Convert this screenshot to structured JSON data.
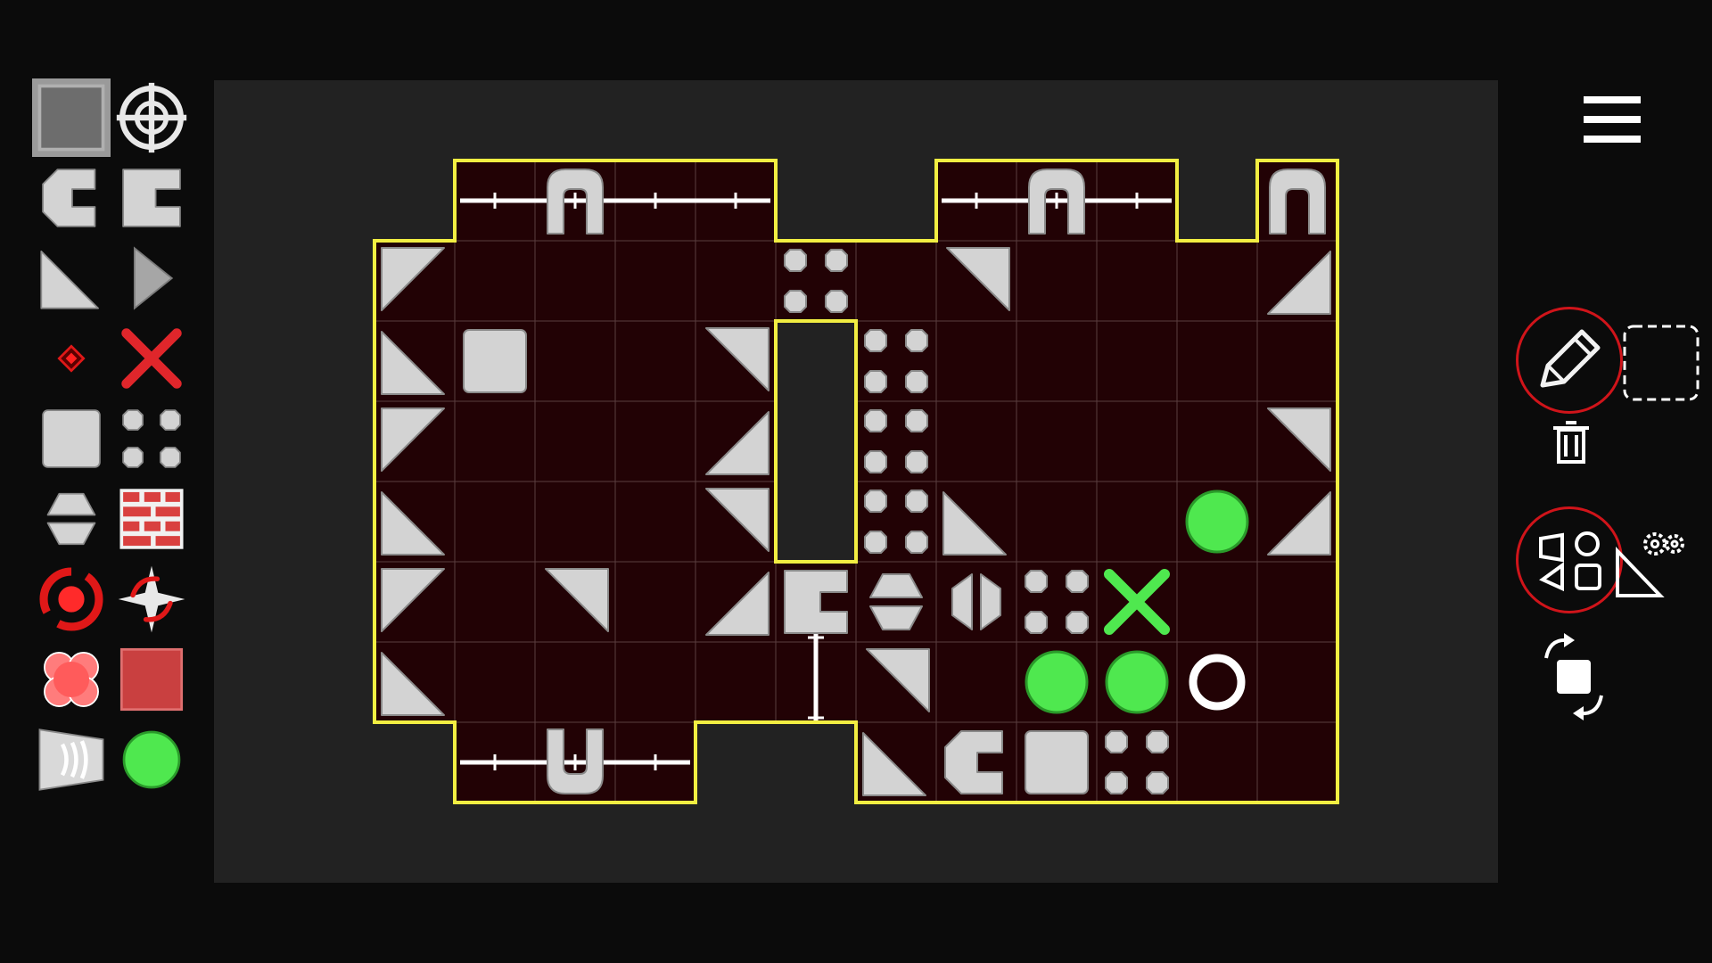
{
  "theme": {
    "page_bg": "#0b0b0b",
    "board_area_bg": "#222222",
    "cell_bg": "#220205",
    "grid_line": "#5a3e40",
    "outline": "#f2ee42",
    "block": "#d3d3d3",
    "accent_red": "#e0262b",
    "accent_green": "#4fe84f",
    "tool_ring": "#d0141a"
  },
  "palette": {
    "selected_index": 0,
    "items": [
      {
        "icon": "floor-tile-icon"
      },
      {
        "icon": "crosshair-target-icon"
      },
      {
        "icon": "c-block-icon"
      },
      {
        "icon": "bracket-block-icon"
      },
      {
        "icon": "triangle-block-icon"
      },
      {
        "icon": "arrow-tip-block-icon"
      },
      {
        "icon": "red-diamond-icon"
      },
      {
        "icon": "red-x-icon"
      },
      {
        "icon": "square-block-icon"
      },
      {
        "icon": "split-block-icon"
      },
      {
        "icon": "hourglass-block-icon"
      },
      {
        "icon": "brick-wall-icon"
      },
      {
        "icon": "red-rotator-icon"
      },
      {
        "icon": "spinner-star-icon"
      },
      {
        "icon": "red-cluster-icon"
      },
      {
        "icon": "red-square-icon"
      },
      {
        "icon": "speaker-block-icon"
      },
      {
        "icon": "green-ball-icon"
      }
    ]
  },
  "board": {
    "cells": [
      [
        1,
        0
      ],
      [
        2,
        0
      ],
      [
        3,
        0
      ],
      [
        4,
        0
      ],
      [
        7,
        0
      ],
      [
        8,
        0
      ],
      [
        9,
        0
      ],
      [
        11,
        0
      ],
      [
        0,
        1
      ],
      [
        1,
        1
      ],
      [
        2,
        1
      ],
      [
        3,
        1
      ],
      [
        4,
        1
      ],
      [
        5,
        1
      ],
      [
        6,
        1
      ],
      [
        7,
        1
      ],
      [
        8,
        1
      ],
      [
        9,
        1
      ],
      [
        10,
        1
      ],
      [
        11,
        1
      ],
      [
        0,
        2
      ],
      [
        1,
        2
      ],
      [
        2,
        2
      ],
      [
        3,
        2
      ],
      [
        4,
        2
      ],
      [
        6,
        2
      ],
      [
        7,
        2
      ],
      [
        8,
        2
      ],
      [
        9,
        2
      ],
      [
        10,
        2
      ],
      [
        11,
        2
      ],
      [
        0,
        3
      ],
      [
        1,
        3
      ],
      [
        2,
        3
      ],
      [
        3,
        3
      ],
      [
        4,
        3
      ],
      [
        6,
        3
      ],
      [
        7,
        3
      ],
      [
        8,
        3
      ],
      [
        9,
        3
      ],
      [
        10,
        3
      ],
      [
        11,
        3
      ],
      [
        0,
        4
      ],
      [
        1,
        4
      ],
      [
        2,
        4
      ],
      [
        3,
        4
      ],
      [
        4,
        4
      ],
      [
        6,
        4
      ],
      [
        7,
        4
      ],
      [
        8,
        4
      ],
      [
        9,
        4
      ],
      [
        10,
        4
      ],
      [
        11,
        4
      ],
      [
        0,
        5
      ],
      [
        1,
        5
      ],
      [
        2,
        5
      ],
      [
        3,
        5
      ],
      [
        4,
        5
      ],
      [
        5,
        5
      ],
      [
        6,
        5
      ],
      [
        7,
        5
      ],
      [
        8,
        5
      ],
      [
        9,
        5
      ],
      [
        10,
        5
      ],
      [
        11,
        5
      ],
      [
        0,
        6
      ],
      [
        1,
        6
      ],
      [
        2,
        6
      ],
      [
        3,
        6
      ],
      [
        4,
        6
      ],
      [
        5,
        6
      ],
      [
        6,
        6
      ],
      [
        7,
        6
      ],
      [
        8,
        6
      ],
      [
        9,
        6
      ],
      [
        10,
        6
      ],
      [
        11,
        6
      ],
      [
        1,
        7
      ],
      [
        2,
        7
      ],
      [
        3,
        7
      ],
      [
        6,
        7
      ],
      [
        7,
        7
      ],
      [
        8,
        7
      ],
      [
        9,
        7
      ],
      [
        10,
        7
      ],
      [
        11,
        7
      ]
    ],
    "rails": [
      {
        "dir": "h",
        "row": 0,
        "from": 1,
        "to": 4
      },
      {
        "dir": "h",
        "row": 0,
        "from": 7,
        "to": 9
      },
      {
        "dir": "h",
        "row": 7,
        "from": 1,
        "to": 3
      },
      {
        "dir": "v",
        "col": 5,
        "from": 5,
        "to": 6
      }
    ],
    "pieces": [
      {
        "c": 2,
        "r": 0,
        "t": "arch",
        "o": "down"
      },
      {
        "c": 8,
        "r": 0,
        "t": "arch",
        "o": "down"
      },
      {
        "c": 11,
        "r": 0,
        "t": "arch",
        "o": "down"
      },
      {
        "c": 0,
        "r": 1,
        "t": "tri",
        "o": "tl"
      },
      {
        "c": 5,
        "r": 1,
        "t": "quad"
      },
      {
        "c": 7,
        "r": 1,
        "t": "tri",
        "o": "tr"
      },
      {
        "c": 11,
        "r": 1,
        "t": "tri",
        "o": "br"
      },
      {
        "c": 0,
        "r": 2,
        "t": "tri",
        "o": "bl"
      },
      {
        "c": 1,
        "r": 2,
        "t": "square"
      },
      {
        "c": 4,
        "r": 2,
        "t": "tri",
        "o": "tr"
      },
      {
        "c": 6,
        "r": 2,
        "t": "quad"
      },
      {
        "c": 0,
        "r": 3,
        "t": "tri",
        "o": "tl"
      },
      {
        "c": 4,
        "r": 3,
        "t": "tri",
        "o": "br"
      },
      {
        "c": 6,
        "r": 3,
        "t": "quad"
      },
      {
        "c": 11,
        "r": 3,
        "t": "tri",
        "o": "tr"
      },
      {
        "c": 0,
        "r": 4,
        "t": "tri",
        "o": "bl"
      },
      {
        "c": 4,
        "r": 4,
        "t": "tri",
        "o": "tr"
      },
      {
        "c": 6,
        "r": 4,
        "t": "quad"
      },
      {
        "c": 7,
        "r": 4,
        "t": "tri",
        "o": "bl"
      },
      {
        "c": 10,
        "r": 4,
        "t": "ball"
      },
      {
        "c": 11,
        "r": 4,
        "t": "tri",
        "o": "br"
      },
      {
        "c": 0,
        "r": 5,
        "t": "tri",
        "o": "tl"
      },
      {
        "c": 2,
        "r": 5,
        "t": "tri",
        "o": "tr"
      },
      {
        "c": 4,
        "r": 5,
        "t": "tri",
        "o": "br"
      },
      {
        "c": 5,
        "r": 5,
        "t": "bracket"
      },
      {
        "c": 6,
        "r": 5,
        "t": "hourglass"
      },
      {
        "c": 7,
        "r": 5,
        "t": "split"
      },
      {
        "c": 8,
        "r": 5,
        "t": "quad"
      },
      {
        "c": 9,
        "r": 5,
        "t": "x"
      },
      {
        "c": 0,
        "r": 6,
        "t": "tri",
        "o": "bl"
      },
      {
        "c": 6,
        "r": 6,
        "t": "tri",
        "o": "tr"
      },
      {
        "c": 8,
        "r": 6,
        "t": "ball"
      },
      {
        "c": 9,
        "r": 6,
        "t": "ball"
      },
      {
        "c": 10,
        "r": 6,
        "t": "ring"
      },
      {
        "c": 2,
        "r": 7,
        "t": "arch",
        "o": "up"
      },
      {
        "c": 6,
        "r": 7,
        "t": "tri",
        "o": "bl"
      },
      {
        "c": 7,
        "r": 7,
        "t": "cblock"
      },
      {
        "c": 8,
        "r": 7,
        "t": "square"
      },
      {
        "c": 9,
        "r": 7,
        "t": "quad"
      }
    ]
  },
  "toolbar": {
    "tools": [
      {
        "name": "menu-button",
        "icon": "hamburger-menu-icon",
        "active": false
      },
      {
        "name": "pencil-tool-button",
        "icon": "pencil-icon",
        "active": true
      },
      {
        "name": "selection-tool-button",
        "icon": "dashed-selection-icon",
        "active": false
      },
      {
        "name": "delete-button",
        "icon": "trash-icon",
        "active": false
      },
      {
        "name": "shapes-tool-button",
        "icon": "shapes-icon",
        "active": true
      },
      {
        "name": "shape-settings-button",
        "icon": "gear-triangle-icon",
        "active": false
      },
      {
        "name": "rotate-button",
        "icon": "rotate-icon",
        "active": false
      }
    ]
  }
}
